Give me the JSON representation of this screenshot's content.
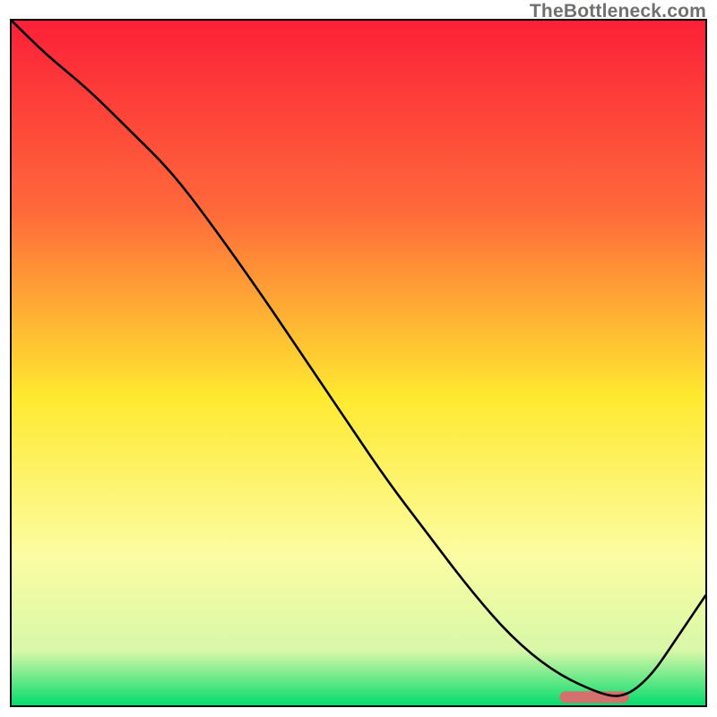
{
  "attribution": "TheBottleneck.com",
  "colors": {
    "gradient_top": "#fb2038",
    "gradient_mid1": "#ff8a3a",
    "gradient_mid2": "#ffe930",
    "gradient_mid3": "#fcfda2",
    "gradient_bottom": "#05db6d",
    "curve": "#000000",
    "marker": "#d4716e",
    "frame": "#000000"
  },
  "chart_data": {
    "type": "line",
    "title": "",
    "xlabel": "",
    "ylabel": "",
    "xlim": [
      0,
      100
    ],
    "ylim": [
      0,
      100
    ],
    "series": [
      {
        "name": "bottleneck-curve",
        "x": [
          0,
          5,
          11,
          17,
          23,
          29,
          36,
          42,
          48,
          54,
          60,
          66,
          72,
          78,
          84,
          88,
          92,
          96,
          100
        ],
        "values": [
          100,
          95,
          90,
          84,
          78,
          70,
          60,
          51,
          42,
          33,
          25,
          17,
          10,
          5,
          2,
          1,
          4,
          10,
          16
        ]
      }
    ],
    "marker": {
      "name": "optimal-range",
      "x_start": 79,
      "x_end": 89,
      "y": 1.2
    },
    "gradient_stops": [
      {
        "offset": 0,
        "color": "#fb2038"
      },
      {
        "offset": 28,
        "color": "#ff6a3a"
      },
      {
        "offset": 55,
        "color": "#ffe930"
      },
      {
        "offset": 78,
        "color": "#fcfda2"
      },
      {
        "offset": 92,
        "color": "#d8f8a8"
      },
      {
        "offset": 100,
        "color": "#05db6d"
      }
    ]
  }
}
